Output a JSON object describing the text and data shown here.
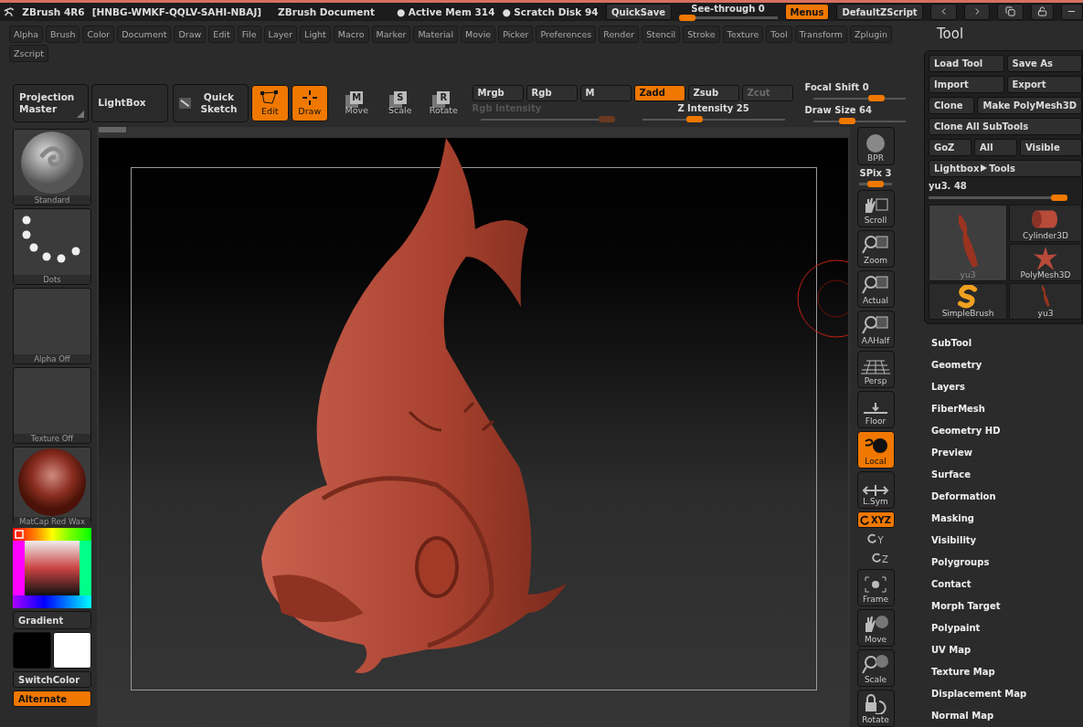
{
  "title_bar": {
    "app": "ZBrush 4R6",
    "key": "[HNBG-WMKF-QQLV-SAHI-NBAJ]",
    "document": "ZBrush Document",
    "memory": "● Active Mem 314",
    "disk": "● Scratch Disk 94",
    "quicksave": "QuickSave",
    "see_through": {
      "label": "See-through",
      "value": "0",
      "level": 0.0
    },
    "menus": {
      "label": "Menus",
      "on": true
    },
    "script": "DefaultZScript"
  },
  "menubar": [
    "Alpha",
    "Brush",
    "Color",
    "Document",
    "Draw",
    "Edit",
    "File",
    "Layer",
    "Light",
    "Macro",
    "Marker",
    "Material",
    "Movie",
    "Picker",
    "Preferences",
    "Render",
    "Stencil",
    "Stroke",
    "Texture",
    "Tool",
    "Transform",
    "Zplugin",
    "Zscript"
  ],
  "toolbar": {
    "projection_master": "Projection Master",
    "lightbox": "LightBox",
    "quick_sketch": "Quick Sketch",
    "modes": [
      {
        "kind": "edit",
        "label": "Edit",
        "on": true
      },
      {
        "kind": "draw",
        "label": "Draw",
        "on": true
      }
    ],
    "transforms": [
      {
        "letter": "M",
        "label": "Move",
        "on": false
      },
      {
        "letter": "S",
        "label": "Scale",
        "on": false
      },
      {
        "letter": "R",
        "label": "Rotate",
        "on": false
      }
    ],
    "channels": [
      {
        "label": "Mrgb",
        "selected": false,
        "disabled": false
      },
      {
        "label": "Rgb",
        "selected": false,
        "disabled": false
      },
      {
        "label": "M",
        "selected": false,
        "disabled": false
      }
    ],
    "depth_modes": [
      {
        "label": "Zadd",
        "selected": true,
        "disabled": false
      },
      {
        "label": "Zsub",
        "selected": false,
        "disabled": false
      },
      {
        "label": "Zcut",
        "selected": false,
        "disabled": true
      }
    ],
    "rgb_intensity": {
      "label": "Rgb Intensity",
      "level": 0.95,
      "disabled": true
    },
    "z_intensity": {
      "label": "Z Intensity",
      "value": "25",
      "level": 0.37
    },
    "focal_shift": {
      "label": "Focal Shift",
      "value": "0",
      "level": 0.68
    },
    "draw_size": {
      "label": "Draw Size",
      "value": "64",
      "level": 0.37
    }
  },
  "left_shelf": {
    "tiles": [
      {
        "kind": "brush",
        "label": "Standard"
      },
      {
        "kind": "stroke",
        "label": "Dots"
      },
      {
        "kind": "empty",
        "label": "Alpha Off"
      },
      {
        "kind": "empty",
        "label": "Texture Off"
      },
      {
        "kind": "material",
        "label": "MatCap Red Wax"
      }
    ],
    "gradient": "Gradient",
    "switch_color": "SwitchColor",
    "alternate": {
      "label": "Alternate",
      "on": true
    }
  },
  "right_shelf": {
    "bpr": "BPR",
    "spix": {
      "label": "SPix",
      "value": "3",
      "level": 0.5
    },
    "buttons": [
      {
        "kind": "scroll",
        "label": "Scroll",
        "on": false
      },
      {
        "kind": "zoom",
        "label": "Zoom",
        "on": false
      },
      {
        "kind": "actual",
        "label": "Actual",
        "on": false
      },
      {
        "kind": "aahalf",
        "label": "AAHalf",
        "on": false
      },
      {
        "kind": "persp",
        "label": "Persp",
        "on": false
      },
      {
        "kind": "floor",
        "label": "Floor",
        "on": false
      },
      {
        "kind": "local",
        "label": "Local",
        "on": true
      },
      {
        "kind": "lsym",
        "label": "L.Sym",
        "on": false
      },
      {
        "kind": "xyz",
        "label": "XYZ",
        "on": true
      },
      {
        "kind": "y",
        "label": "Y",
        "on": false
      },
      {
        "kind": "z",
        "label": "Z",
        "on": false
      },
      {
        "kind": "frame",
        "label": "Frame",
        "on": false
      },
      {
        "kind": "move",
        "label": "Move",
        "on": false
      },
      {
        "kind": "scale",
        "label": "Scale",
        "on": false
      },
      {
        "kind": "rotate",
        "label": "Rotate",
        "on": false
      }
    ]
  },
  "tool_panel": {
    "title": "Tool",
    "button_rows": [
      [
        "Load Tool",
        "Save As"
      ],
      [
        "Import",
        "Export"
      ],
      [
        "Clone",
        "Make PolyMesh3D"
      ],
      [
        "Clone All SubTools"
      ],
      [
        "GoZ",
        "All",
        "Visible"
      ]
    ],
    "lightbox": {
      "left": "Lightbox",
      "right": "Tools"
    },
    "tool_slider": {
      "label": "yu3. 48",
      "level": 0.95
    },
    "tools": [
      {
        "kind": "fish",
        "label": "yu3",
        "selected": true
      },
      {
        "kind": "simplebrush",
        "label": "SimpleBrush",
        "selected": false
      },
      {
        "kind": "cylinder",
        "label": "Cylinder3D",
        "selected": false
      },
      {
        "kind": "star",
        "label": "PolyMesh3D",
        "selected": false
      },
      {
        "kind": "fish",
        "label": "yu3",
        "selected": false
      }
    ],
    "sections": [
      "SubTool",
      "Geometry",
      "Layers",
      "FiberMesh",
      "Geometry HD",
      "Preview",
      "Surface",
      "Deformation",
      "Masking",
      "Visibility",
      "Polygroups",
      "Contact",
      "Morph Target",
      "Polypaint",
      "UV Map",
      "Texture Map",
      "Displacement Map",
      "Normal Map"
    ]
  }
}
